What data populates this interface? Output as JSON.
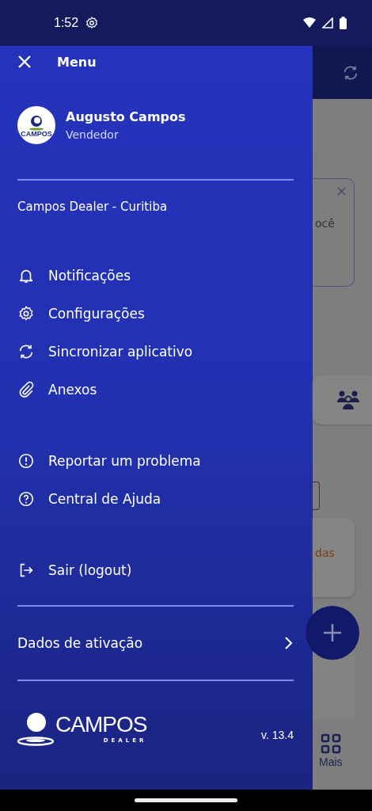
{
  "status_bar": {
    "time": "1:52"
  },
  "drawer": {
    "title": "Menu",
    "user": {
      "name": "Augusto Campos",
      "role": "Vendedor",
      "avatar_text": "CAMPOS"
    },
    "store": "Campos Dealer - Curitiba",
    "groups": [
      [
        {
          "label": "Notificações"
        },
        {
          "label": "Configurações"
        },
        {
          "label": "Sincronizar aplicativo"
        },
        {
          "label": "Anexos"
        }
      ],
      [
        {
          "label": "Reportar um problema"
        },
        {
          "label": "Central de Ajuda"
        }
      ],
      [
        {
          "label": "Sair (logout)"
        }
      ]
    ],
    "activation": "Dados de ativação",
    "logo": {
      "name": "CAMPOS",
      "tagline": "DEALER"
    },
    "version": "v. 13.4"
  },
  "background_app": {
    "notice_text": "ocê",
    "card_text": "das",
    "nav_label": "Mais"
  }
}
